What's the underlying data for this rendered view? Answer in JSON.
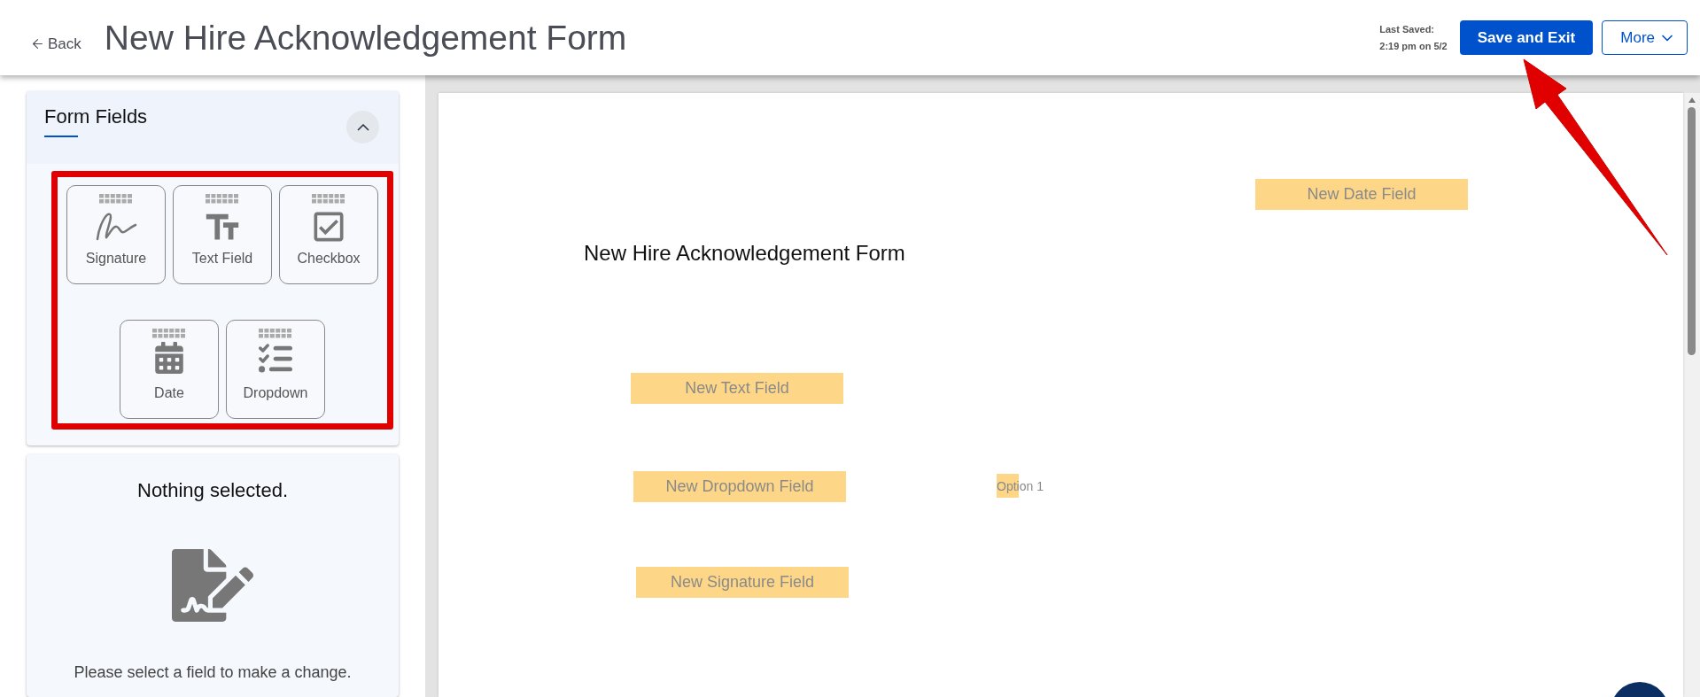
{
  "header": {
    "back_label": "Back",
    "title": "New Hire Acknowledgement Form",
    "last_saved_label": "Last Saved:",
    "last_saved_time": "2:19 pm on 5/2",
    "save_button": "Save and Exit",
    "more_button": "More"
  },
  "form_fields_panel": {
    "title": "Form Fields",
    "expanded": true,
    "tiles": [
      {
        "kind": "signature",
        "label": "Signature"
      },
      {
        "kind": "text",
        "label": "Text Field"
      },
      {
        "kind": "checkbox",
        "label": "Checkbox"
      },
      {
        "kind": "date",
        "label": "Date"
      },
      {
        "kind": "dropdown",
        "label": "Dropdown"
      }
    ]
  },
  "properties_panel": {
    "heading": "Nothing selected.",
    "message": "Please select a field to make a change."
  },
  "document": {
    "title": "New Hire Acknowledgement Form",
    "fields": [
      {
        "kind": "date",
        "label": "New Date Field"
      },
      {
        "kind": "text",
        "label": "New Text Field"
      },
      {
        "kind": "dropdown",
        "label": "New Dropdown Field"
      },
      {
        "kind": "option",
        "label": "Option 1"
      },
      {
        "kind": "signature",
        "label": "New Signature Field"
      }
    ]
  }
}
